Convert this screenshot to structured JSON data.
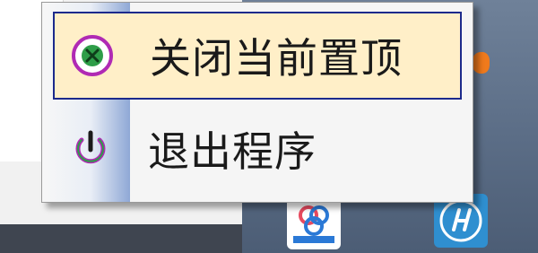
{
  "context_menu": {
    "items": [
      {
        "label": "关闭当前置顶",
        "icon": "close-circle-icon",
        "highlighted": true
      },
      {
        "label": "退出程序",
        "icon": "power-icon",
        "highlighted": false
      }
    ]
  },
  "taskbar": {
    "tray_icons": [
      "app-tray-icon",
      "hp-tray-icon"
    ]
  },
  "colors": {
    "highlight_bg": "#ffefc8",
    "highlight_border": "#1c2a8c",
    "icon_green": "#2e9d48",
    "icon_magenta": "#b02ab4",
    "taskbar": "#5b6d86"
  }
}
